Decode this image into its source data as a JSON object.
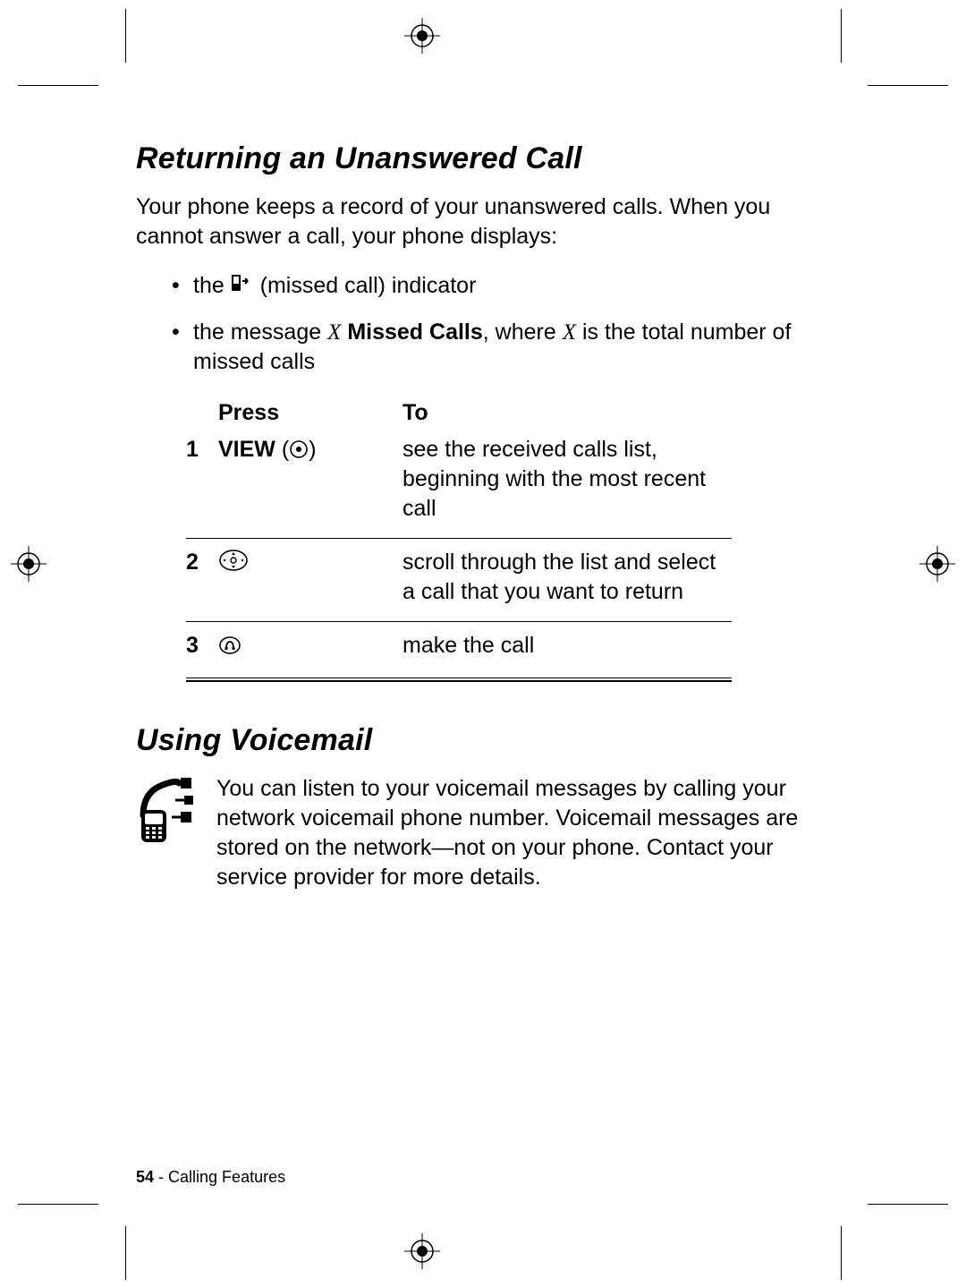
{
  "section1": {
    "heading": "Returning an Unanswered Call",
    "intro": "Your phone keeps a record of your unanswered calls. When you cannot answer a call, your phone displays:",
    "bullet1_pre": "the ",
    "bullet1_post": " (missed call) indicator",
    "bullet2_pre": "the message ",
    "bullet2_var1": "X",
    "bullet2_bold": " Missed Calls",
    "bullet2_mid": ", where ",
    "bullet2_var2": "X",
    "bullet2_post": " is the total number of missed calls"
  },
  "table": {
    "col_press": "Press",
    "col_to": "To",
    "rows": [
      {
        "num": "1",
        "press_label": "VIEW",
        "to": "see the received calls list, beginning with the most recent call"
      },
      {
        "num": "2",
        "press_label": "",
        "to": "scroll through the list and select a call that you want to return"
      },
      {
        "num": "3",
        "press_label": "",
        "to": "make the call"
      }
    ]
  },
  "section2": {
    "heading": "Using Voicemail",
    "text": "You can listen to your voicemail messages by calling your network voicemail phone number. Voicemail messages are stored on the network—not on your phone. Contact your service provider for more details."
  },
  "footer": {
    "page_num": "54",
    "sep": " - ",
    "section_name": "Calling Features"
  }
}
